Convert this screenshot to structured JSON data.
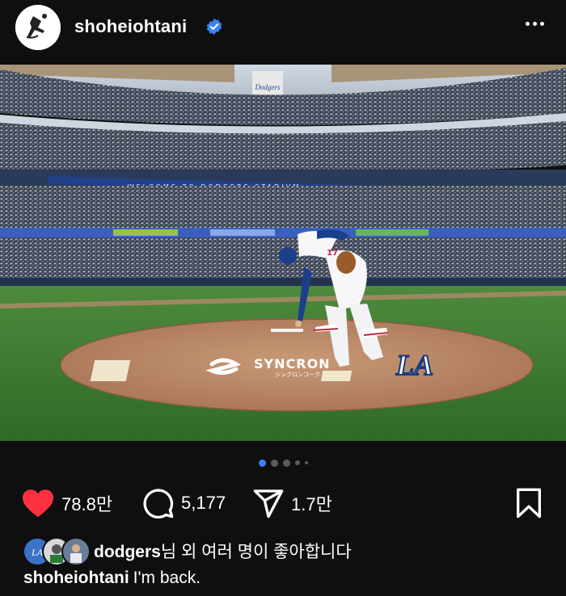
{
  "post": {
    "username": "shoheiohtani",
    "verified": true
  },
  "photo": {
    "banner_text": "WELCOME TO DODGERS STADIUM",
    "mound_brand": "SYNCRON",
    "mound_brand_sub": "シンクロンコーク",
    "team_logo": "LA",
    "player_number": "17",
    "stadium_sign": "Dodgers"
  },
  "carousel": {
    "count": 5,
    "active": 0
  },
  "actions": {
    "likes": "78.8만",
    "comments": "5,177",
    "shares": "1.7만"
  },
  "liked_by": {
    "username": "dodgers",
    "suffix": "님 외 여러 명이 좋아합니다"
  },
  "caption": {
    "username": "shoheiohtani",
    "text": "I'm back."
  },
  "colors": {
    "like": "#ff3040",
    "verified": "#3b82f6",
    "active_dot": "#3b82f6"
  },
  "icons": [
    "baseball-player-avatar-icon",
    "verified-badge-icon",
    "more-options-icon",
    "heart-icon",
    "comment-icon",
    "share-icon",
    "bookmark-icon"
  ]
}
